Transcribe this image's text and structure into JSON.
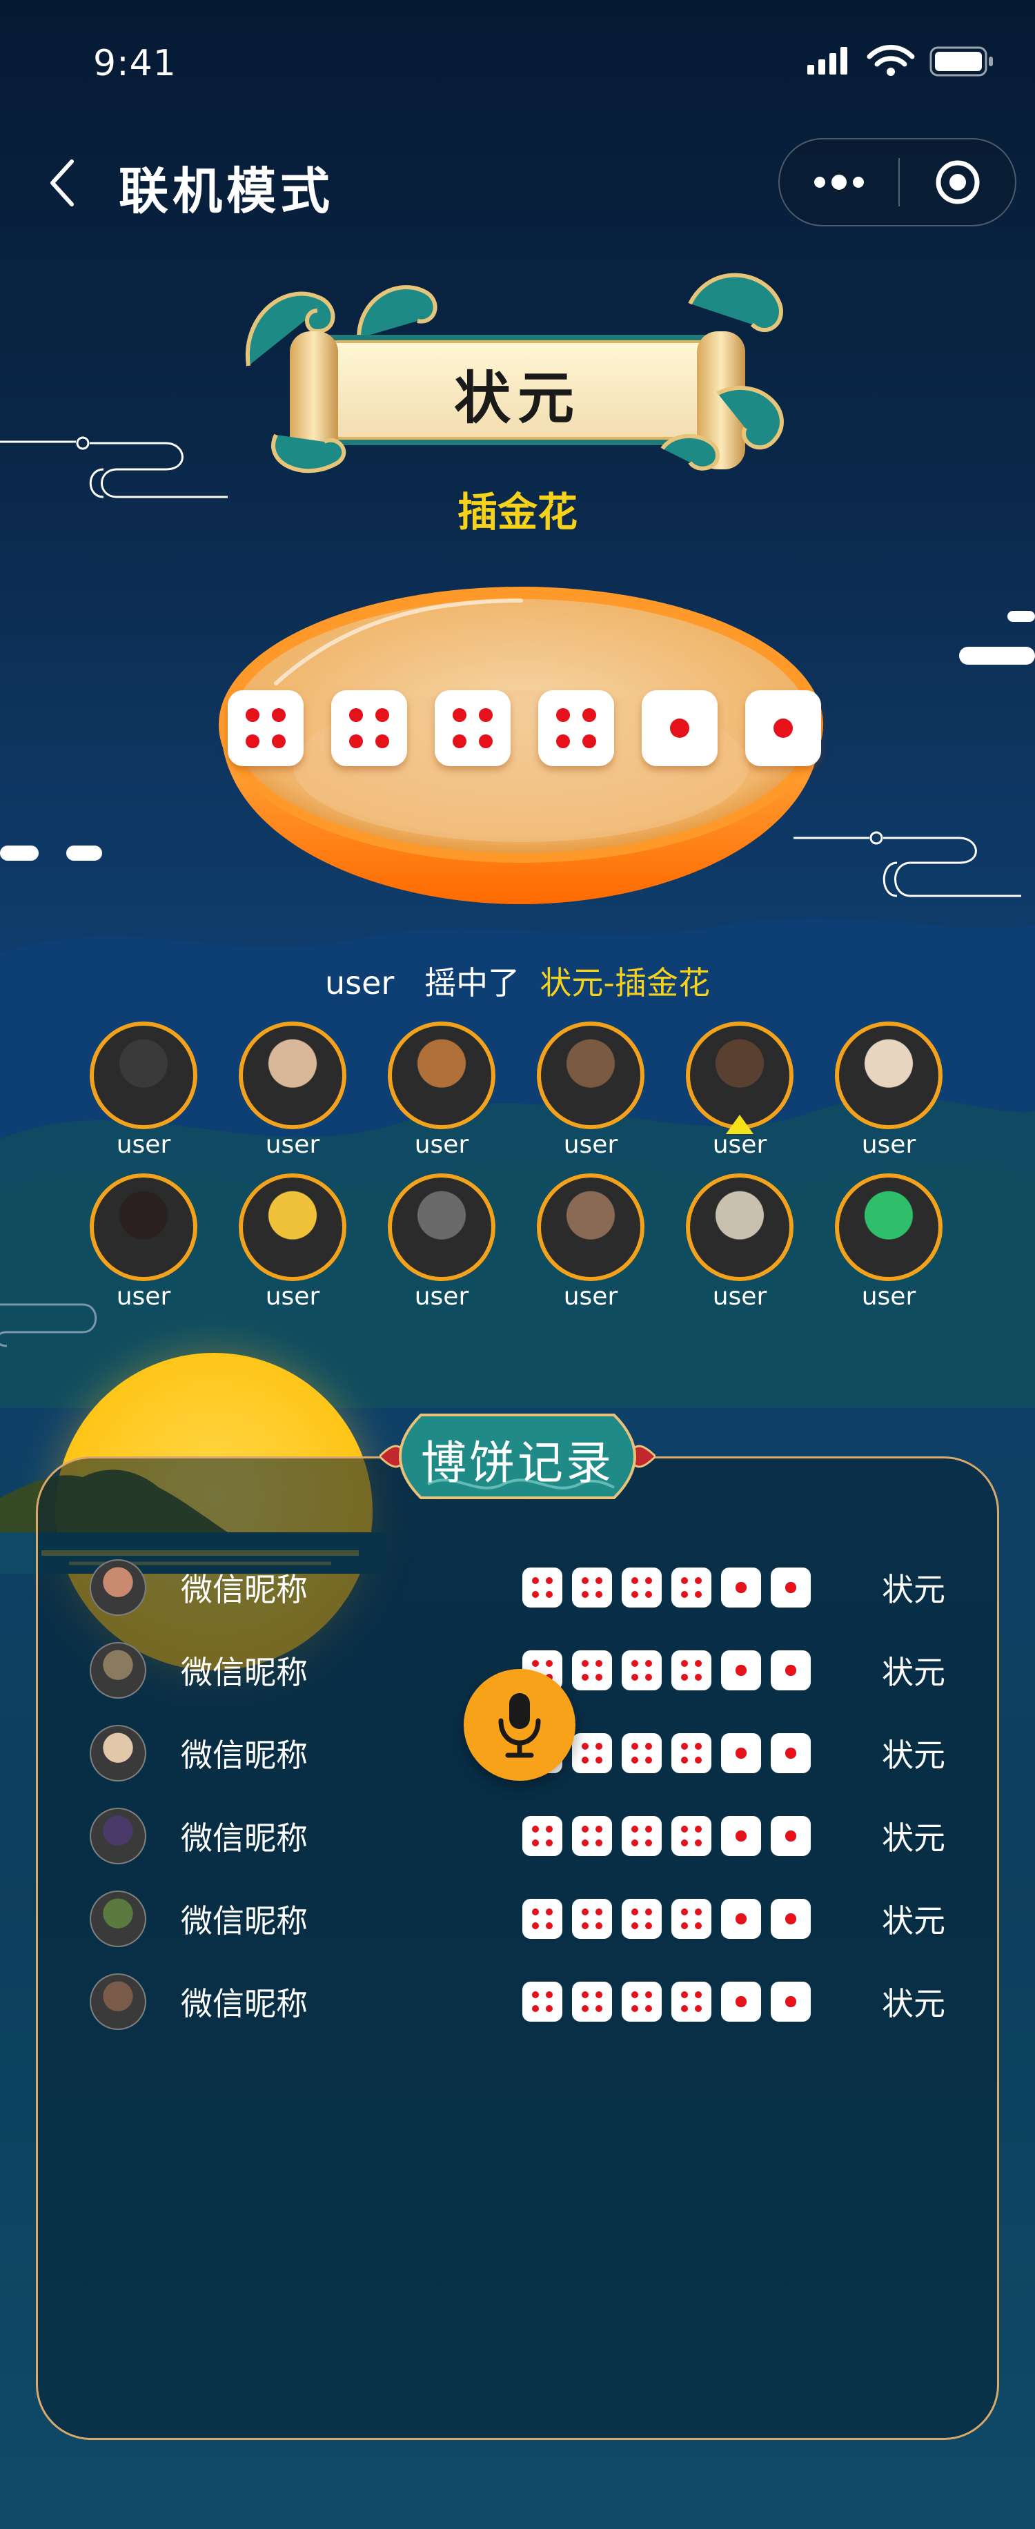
{
  "status_bar": {
    "time": "9:41"
  },
  "nav": {
    "title": "联机模式"
  },
  "banner": {
    "title": "状元",
    "subtitle": "插金花"
  },
  "bowl_dice": [
    4,
    4,
    4,
    4,
    1,
    1
  ],
  "result": {
    "user": "user",
    "action": "摇中了",
    "value": "状元-插金花"
  },
  "players": [
    {
      "name": "user",
      "color": "#3a3a3a"
    },
    {
      "name": "user",
      "color": "#d9b89a"
    },
    {
      "name": "user",
      "color": "#b0703a"
    },
    {
      "name": "user",
      "color": "#7a5a40"
    },
    {
      "name": "user",
      "color": "#5a4030",
      "current": true
    },
    {
      "name": "user",
      "color": "#e8d5c0"
    },
    {
      "name": "user",
      "color": "#2a2020"
    },
    {
      "name": "user",
      "color": "#f0c23a"
    },
    {
      "name": "user",
      "color": "#6a6a6a"
    },
    {
      "name": "user",
      "color": "#8a6a55"
    },
    {
      "name": "user",
      "color": "#c9c0b0"
    },
    {
      "name": "user",
      "color": "#2fbf6a"
    }
  ],
  "records_panel": {
    "title": "博饼记录",
    "rows": [
      {
        "name": "微信昵称",
        "dice": [
          4,
          4,
          4,
          4,
          1,
          1
        ],
        "result": "状元",
        "avatar_color": "#c98a70"
      },
      {
        "name": "微信昵称",
        "dice": [
          4,
          4,
          4,
          4,
          1,
          1
        ],
        "result": "状元",
        "avatar_color": "#8a7a60"
      },
      {
        "name": "微信昵称",
        "dice": [
          4,
          4,
          4,
          4,
          1,
          1
        ],
        "result": "状元",
        "avatar_color": "#e0c8a8"
      },
      {
        "name": "微信昵称",
        "dice": [
          4,
          4,
          4,
          4,
          1,
          1
        ],
        "result": "状元",
        "avatar_color": "#4a3a6a"
      },
      {
        "name": "微信昵称",
        "dice": [
          4,
          4,
          4,
          4,
          1,
          1
        ],
        "result": "状元",
        "avatar_color": "#5a7a40"
      },
      {
        "name": "微信昵称",
        "dice": [
          4,
          4,
          4,
          4,
          1,
          1
        ],
        "result": "状元",
        "avatar_color": "#7a5a48"
      }
    ]
  },
  "icons": {
    "back": "chevron-left-icon",
    "more": "more-dots-icon",
    "target": "target-icon",
    "mic": "microphone-icon"
  },
  "colors": {
    "accent_gold": "#f6d21a",
    "ring_orange": "#f3a21b",
    "pip_red": "#e5121b",
    "mic_orange": "#f7a218"
  }
}
